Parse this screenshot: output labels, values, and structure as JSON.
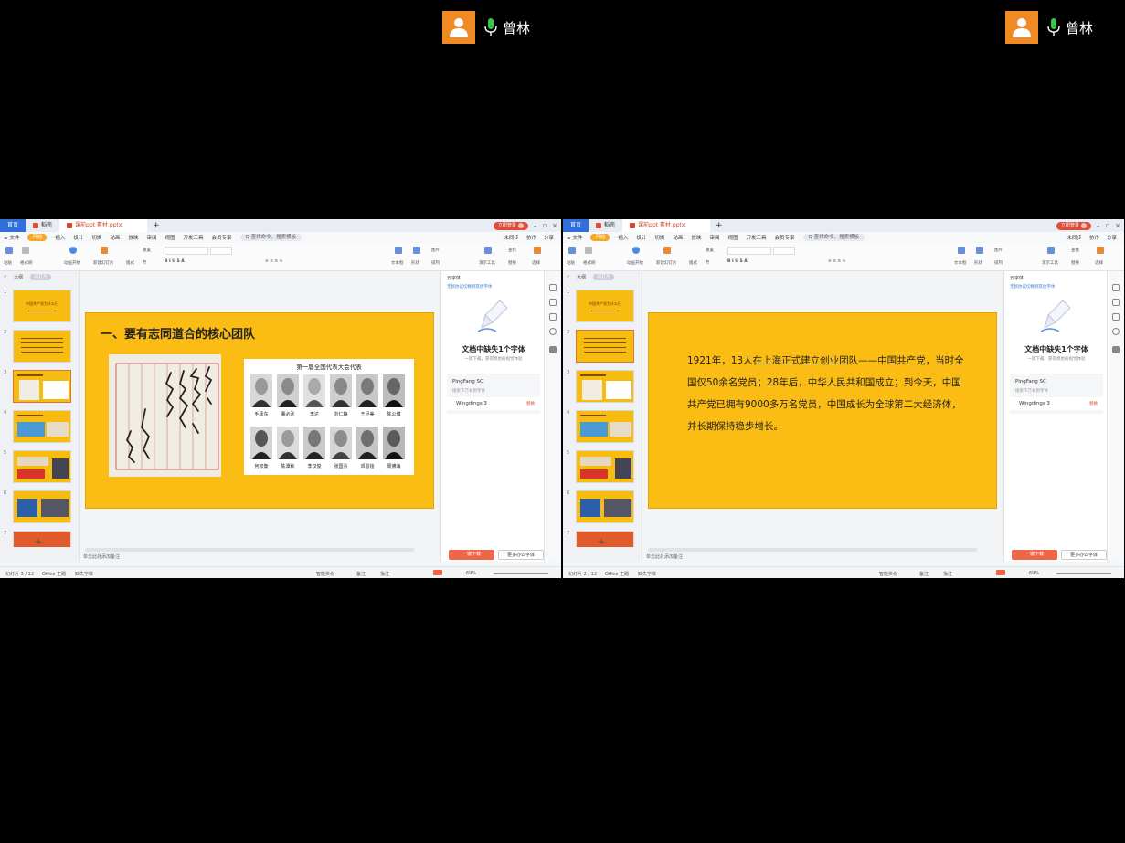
{
  "participant": {
    "name": "曾林"
  },
  "app": {
    "tabs": {
      "home": "首页",
      "store": "稻壳",
      "file": "课前ppt 素材.pptx"
    },
    "login": "立即登录",
    "menu": [
      "≡ 文件",
      "开始",
      "插入",
      "设计",
      "切换",
      "动画",
      "放映",
      "审阅",
      "视图",
      "开发工具",
      "会员专享"
    ],
    "search": "Q 查找命令、搜索模板",
    "menu_right": [
      "未同步",
      "协作",
      "分享"
    ],
    "ribbon": {
      "paste": "粘贴",
      "format_painter": "格式刷",
      "animation": "动画开始",
      "new_slide": "新建幻灯片",
      "layout": "版式",
      "section": "节",
      "reset": "重置",
      "textbox": "文本框",
      "shape": "形状",
      "arrange": "排列",
      "picture": "图片",
      "slideshow": "演示工具",
      "find": "查找",
      "replace": "替换",
      "select": "选择"
    },
    "outline_tab": "大纲",
    "slides_tab": "幻灯片",
    "notes": "单击此处添加备注",
    "colors": {
      "accent": "#F5A623",
      "slide_bg": "#FBBD13",
      "home_tab": "#2F6FD7",
      "primary_btn": "#EF6548"
    }
  },
  "font_panel": {
    "title": "云字体",
    "link": "无损协议切换到其他字体",
    "headline": "文档中缺失1个字体",
    "subline": "一键下载，获得原始的视觉体验",
    "fonts": [
      {
        "name": "PingFang SC",
        "note": "搜索下万长到字体"
      },
      {
        "name": "Wingdings 3",
        "mark": "替换"
      }
    ],
    "download_btn": "一键下载",
    "more_btn": "更多办公字体"
  },
  "left_window": {
    "slide_title": "一、要有志同道合的核心团队",
    "photo_title": "第一届全国代表大会代表",
    "row1_names": [
      "毛泽东",
      "董必武",
      "李达",
      "刘仁静",
      "王尽美",
      "陈公博"
    ],
    "row2_names": [
      "何叔衡",
      "陈潭秋",
      "李汉俊",
      "张国焘",
      "邓恩铭",
      "周佛海"
    ],
    "calligraphy": "鲁迅先生是中国文化革命的主将，他不但是伟大的文学家，而且是伟大的思想家",
    "thumb_title": "中国共产党为什么行",
    "status": {
      "slide_index": "幻灯片 3 / 12",
      "theme": "Office 主题",
      "font_missing": "缺失字体",
      "beautify": "智能美化",
      "notes": "备注",
      "comment": "批注",
      "zoom": "69%"
    }
  },
  "right_window": {
    "slide_text": "1921年，13人在上海正式建立创业团队——中国共产党，当时全国仅50余名党员；28年后，中华人民共和国成立；到今天，中国共产党已拥有9000多万名党员，中国成长为全球第二大经济体，并长期保持稳步增长。",
    "thumb_title": "中国共产党为什么行",
    "status": {
      "slide_index": "幻灯片 2 / 12",
      "theme": "Office 主题",
      "font_missing": "缺失字体",
      "beautify": "智能美化",
      "notes": "备注",
      "comment": "批注",
      "zoom": "69%"
    }
  }
}
